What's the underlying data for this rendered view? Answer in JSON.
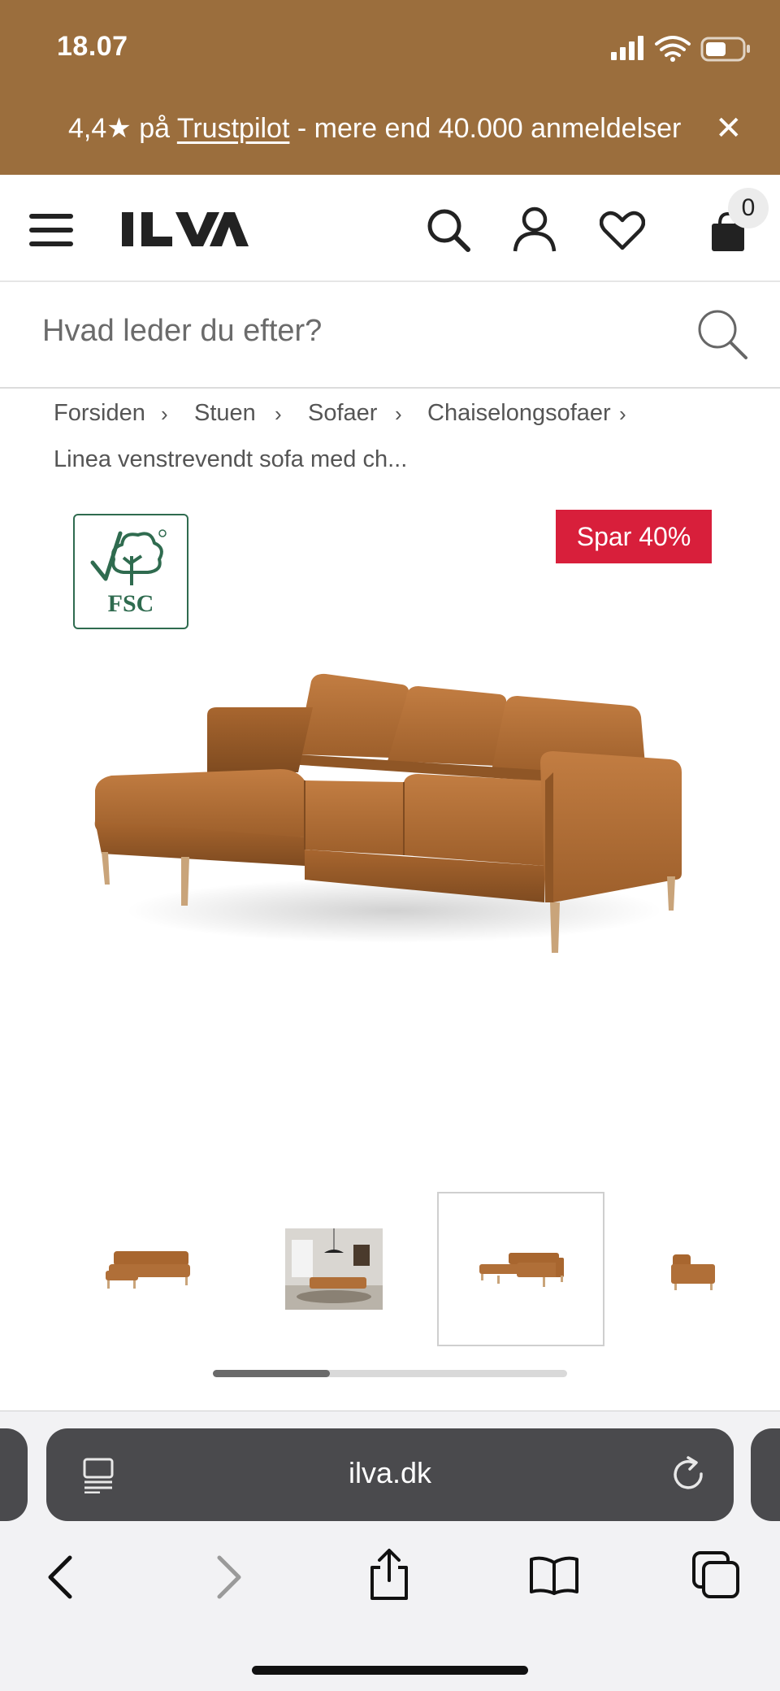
{
  "status": {
    "time": "18.07"
  },
  "promo": {
    "rating_prefix": "4,4★ på ",
    "brand_link": "Trustpilot",
    "rating_suffix": " - mere end 40.000 anmeldelser",
    "close_label": "✕"
  },
  "header": {
    "logo": "ILVA",
    "cart_count": "0"
  },
  "search": {
    "placeholder": "Hvad leder du efter?"
  },
  "breadcrumb": {
    "items": [
      "Forsiden",
      "Stuen",
      "Sofaer",
      "Chaiselongsofaer"
    ],
    "separator": "›",
    "current": "Linea venstrevendt sofa med ch..."
  },
  "product": {
    "certification": "FSC",
    "discount_badge": "Spar 40%",
    "thumbnails_count": 4,
    "active_thumbnail": 3
  },
  "gallery": {
    "scroll_progress": 0.33
  },
  "browser": {
    "url": "ilva.dk"
  },
  "colors": {
    "brand_brown": "#9b6e3d",
    "sale_red": "#d81f3b",
    "fsc_green": "#2f6b4f",
    "sofa_leather": "#b06f38"
  }
}
